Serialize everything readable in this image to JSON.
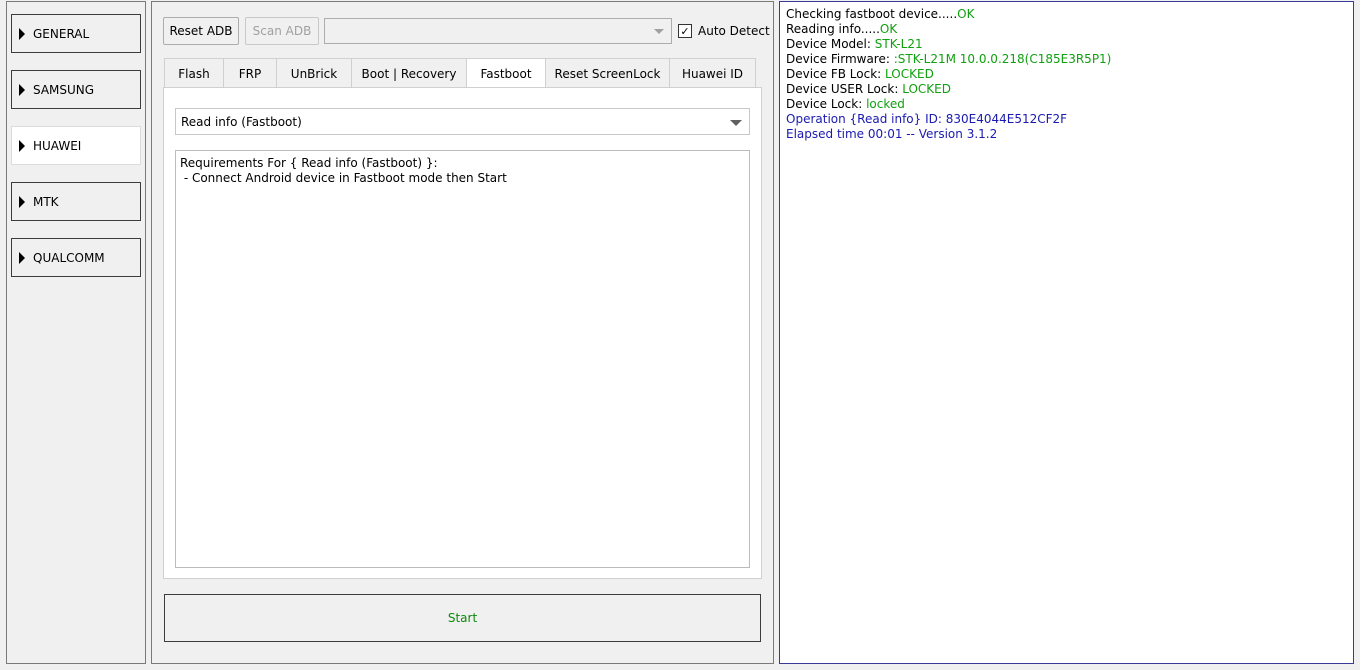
{
  "sidebar": {
    "items": [
      {
        "label": "GENERAL"
      },
      {
        "label": "SAMSUNG"
      },
      {
        "label": "HUAWEI"
      },
      {
        "label": "MTK"
      },
      {
        "label": "QUALCOMM"
      }
    ],
    "active": "HUAWEI",
    "icon": "triangle-right-icon"
  },
  "toolbar": {
    "reset_adb": "Reset ADB",
    "scan_adb": "Scan ADB",
    "device_select_value": "",
    "auto_detect_label": "Auto Detect",
    "auto_detect_checked": true,
    "check_glyph": "✓"
  },
  "tabs": [
    {
      "label": "Flash"
    },
    {
      "label": "FRP"
    },
    {
      "label": "UnBrick"
    },
    {
      "label": "Boot | Recovery"
    },
    {
      "label": "Fastboot"
    },
    {
      "label": "Reset ScreenLock"
    },
    {
      "label": "Huawei ID"
    }
  ],
  "active_tab": "Fastboot",
  "fastboot": {
    "operation_selected": "Read info (Fastboot)",
    "requirements": [
      "Requirements For { Read info (Fastboot) }:",
      " - Connect Android device in Fastboot mode then Start"
    ],
    "start_label": "Start"
  },
  "log": {
    "lines": [
      {
        "label": "Checking fastboot device.....",
        "value": "OK"
      },
      {
        "label": "Reading info.....",
        "value": "OK"
      },
      {
        "label": "Device Model: ",
        "value": "STK-L21"
      },
      {
        "label": "Device Firmware: ",
        "value": ":STK-L21M 10.0.0.218(C185E3R5P1)"
      },
      {
        "label": "Device FB Lock: ",
        "value": "LOCKED"
      },
      {
        "label": "Device USER Lock: ",
        "value": "LOCKED"
      },
      {
        "label": "Device Lock: ",
        "value": "locked"
      }
    ],
    "operation_line": "Operation {Read info} ID: 830E4044E512CF2F",
    "elapsed_line": "Elapsed time 00:01 -- Version 3.1.2"
  },
  "colors": {
    "ok_green": "#10a010",
    "info_blue": "#1a1ab0",
    "start_green": "#0a8a0a"
  }
}
